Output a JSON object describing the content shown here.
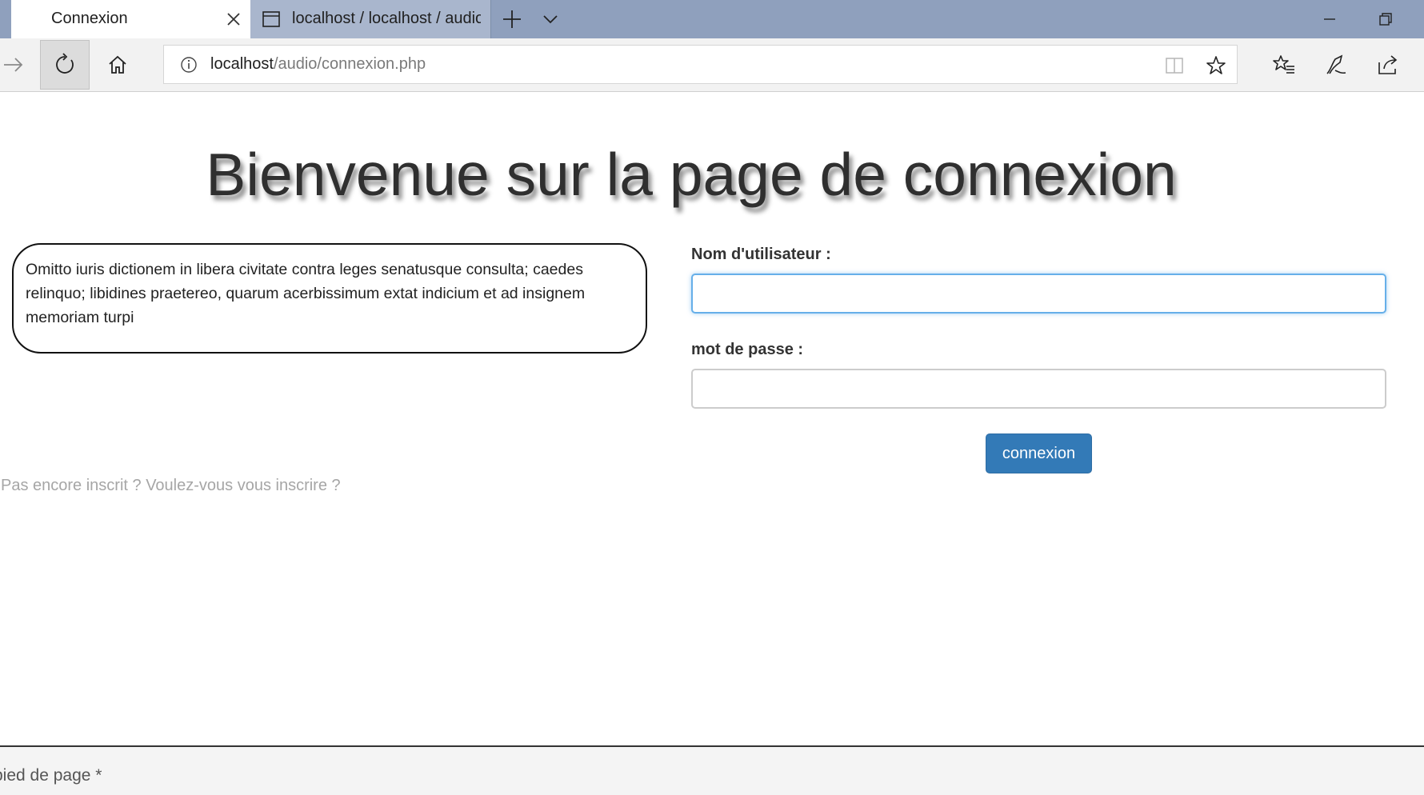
{
  "browser": {
    "tabs": [
      {
        "title": "Connexion",
        "active": true
      },
      {
        "title": "localhost / localhost / audio",
        "active": false
      }
    ],
    "address": {
      "host": "localhost",
      "path": "/audio/connexion.php"
    }
  },
  "page": {
    "title": "Bienvenue sur la page de connexion",
    "intro_text": "Omitto iuris dictionem in libera civitate contra leges senatusque consulta; caedes relinquo; libidines praetereo, quarum acerbissimum extat indicium et ad insignem memoriam turpi",
    "form": {
      "username_label": "Nom d'utilisateur :",
      "username_value": "",
      "password_label": "mot de passe :",
      "password_value": "",
      "submit_label": "connexion"
    },
    "register_link": "Pas encore inscrit ? Voulez-vous vous inscrire ?",
    "footer": "pied de page *"
  },
  "colors": {
    "tabbar_bg": "#8fa0bd",
    "button_primary": "#337ab7",
    "input_focus": "#66afe9",
    "link_muted": "#a6a6a6"
  },
  "icons": [
    "close-icon",
    "page-icon",
    "new-tab-icon",
    "tab-list-chevron-icon",
    "minimize-icon",
    "restore-icon",
    "forward-arrow-icon",
    "refresh-icon",
    "home-icon",
    "info-icon",
    "reading-view-icon",
    "favorite-star-icon",
    "favorites-list-icon",
    "pen-icon",
    "share-icon"
  ]
}
